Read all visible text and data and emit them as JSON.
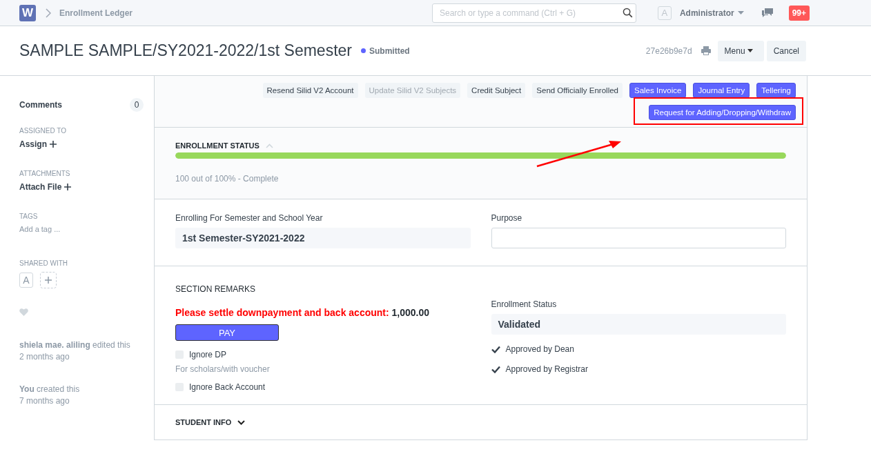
{
  "navbar": {
    "logo": "W",
    "breadcrumb": "Enrollment Ledger",
    "search": {
      "placeholder": "Search or type a command (Ctrl + G)"
    },
    "user_avatar": "A",
    "user": "Administrator",
    "notifications": "99+"
  },
  "page_header": {
    "title": "SAMPLE SAMPLE/SY2021-2022/1st Semester",
    "status": "Submitted",
    "doc_id": "27e26b9e7d",
    "buttons": [
      {
        "label": "Menu",
        "kind": "dropdown"
      },
      {
        "label": "Cancel",
        "kind": "default"
      }
    ]
  },
  "sidebar": {
    "comments": {
      "label": "Comments",
      "count": "0"
    },
    "assigned_to": {
      "heading": "ASSIGNED TO",
      "action": "Assign"
    },
    "attachments": {
      "heading": "ATTACHMENTS",
      "action": "Attach File"
    },
    "tags": {
      "heading": "TAGS",
      "placeholder": "Add a tag ..."
    },
    "shared_with": {
      "heading": "SHARED WITH",
      "avatars": [
        "A"
      ]
    },
    "liked": false,
    "timeline": [
      {
        "text": "**shiela mae. aliling** edited this",
        "time": "2 months ago"
      },
      {
        "text": "**You** created this",
        "time": "7 months ago"
      }
    ]
  },
  "actions": [
    {
      "label": "Resend Silid V2 Account",
      "kind": "default",
      "disabled": false
    },
    {
      "label": "Update Silid V2 Subjects",
      "kind": "default",
      "disabled": true
    },
    {
      "label": "Credit Subject",
      "kind": "default",
      "disabled": false
    },
    {
      "label": "Send Officially Enrolled",
      "kind": "default",
      "disabled": false
    },
    {
      "label": "Sales Invoice",
      "kind": "primary",
      "disabled": false
    },
    {
      "label": "Journal Entry",
      "kind": "primary",
      "disabled": false
    },
    {
      "label": "Tellering",
      "kind": "primary",
      "disabled": false
    },
    {
      "label": "Request for Adding/Dropping/Withdraw",
      "kind": "primary",
      "disabled": false
    }
  ],
  "enrollment_status": {
    "title": "ENROLLMENT STATUS",
    "expanded": true,
    "level": 1.0,
    "caption": "100 out of 100% - Complete"
  },
  "fields": [
    {
      "label": "Enrolling For Semester and School Year",
      "value": "1st Semester-SY2021-2022",
      "kind": "readonly"
    },
    {
      "label": "Purpose",
      "kind": "input"
    }
  ],
  "section_remarks": {
    "title": "SECTION REMARKS",
    "warning": "Please settle downpayment and back account:",
    "amount": "1,000.00",
    "pay_button": "PAY",
    "checkboxes": [
      {
        "label": "Ignore DP",
        "checked": false,
        "description": "For scholars/with voucher"
      },
      {
        "label": "Ignore Back Account",
        "checked": false
      }
    ],
    "status_label": "Enrollment Status",
    "status_value": "Validated",
    "approvals": [
      {
        "label": "Approved by Dean",
        "checked": true
      },
      {
        "label": "Approved by Registrar",
        "checked": true
      }
    ]
  },
  "collapsed_sections": [
    {
      "title": "STUDENT INFO",
      "expanded": false
    }
  ]
}
